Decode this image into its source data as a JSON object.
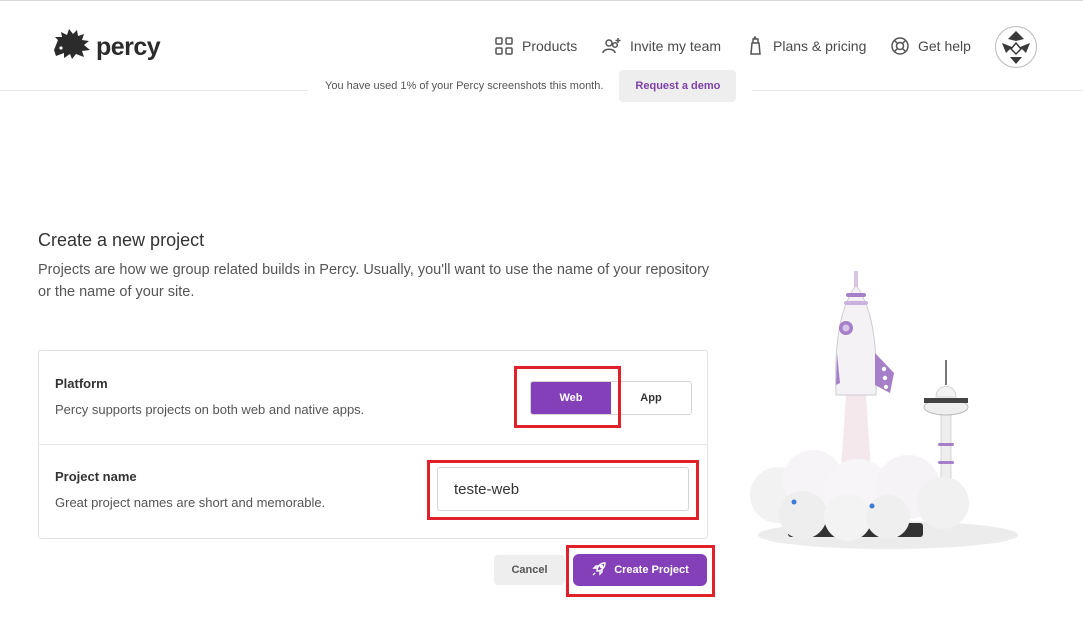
{
  "header": {
    "logo_text": "percy",
    "nav": [
      {
        "label": "Products",
        "icon": "grid-icon"
      },
      {
        "label": "Invite my team",
        "icon": "invite-users-icon"
      },
      {
        "label": "Plans & pricing",
        "icon": "plans-icon"
      },
      {
        "label": "Get help",
        "icon": "lifebuoy-icon"
      }
    ]
  },
  "usage": {
    "text": "You have used 1% of your Percy screenshots this month.",
    "demo_label": "Request a demo"
  },
  "form": {
    "title": "Create a new project",
    "description": "Projects are how we group related builds in Percy. Usually, you'll want to use the name of your repository or the name of your site.",
    "platform": {
      "label": "Platform",
      "help": "Percy supports projects on both web and native apps.",
      "options": [
        "Web",
        "App"
      ],
      "selected": "Web"
    },
    "project_name": {
      "label": "Project name",
      "help": "Great project names are short and memorable.",
      "value": "teste-web"
    },
    "cancel_label": "Cancel",
    "create_label": "Create Project"
  },
  "colors": {
    "accent": "#8440b8",
    "highlight": "#e0202a"
  }
}
